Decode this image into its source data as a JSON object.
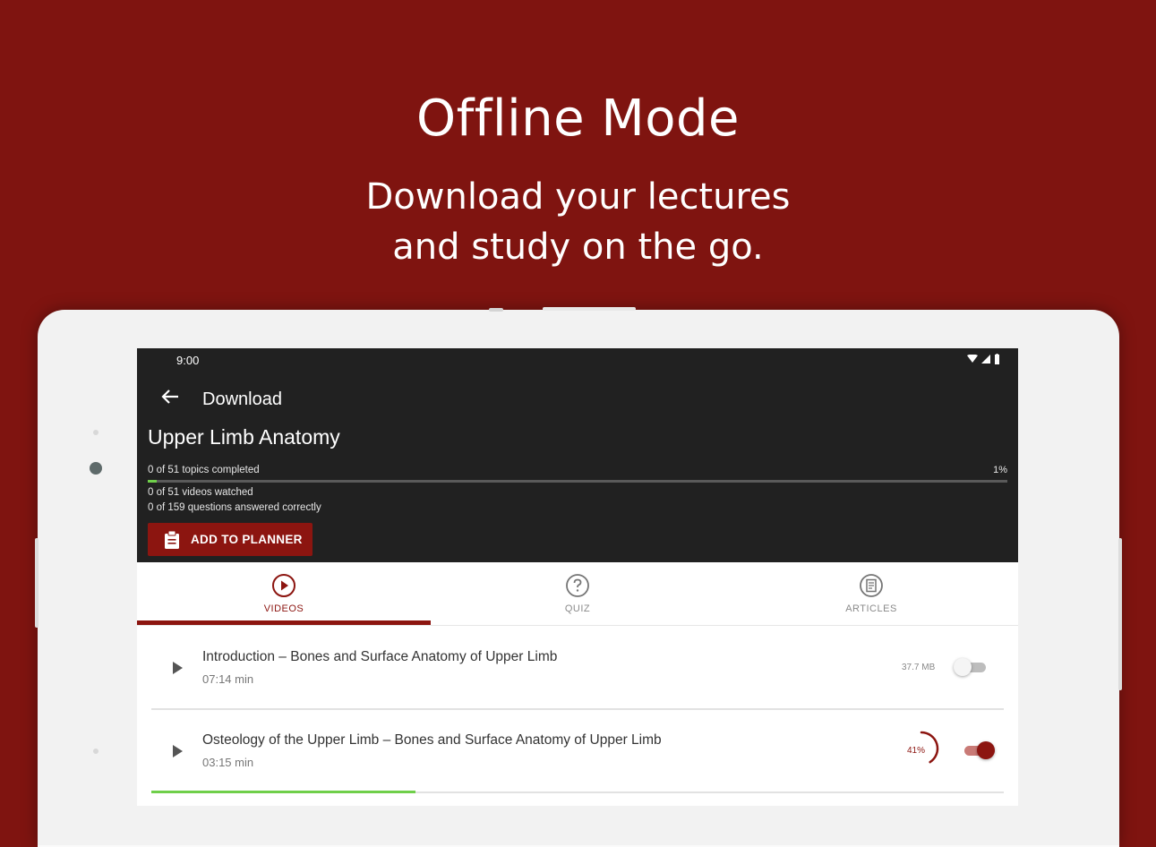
{
  "promo": {
    "headline": "Offline Mode",
    "subline_1": "Download your lectures",
    "subline_2": "and study on the go."
  },
  "status_bar": {
    "time": "9:00"
  },
  "app_bar": {
    "title": "Download",
    "back_icon": "arrow-back-icon"
  },
  "course": {
    "title": "Upper Limb Anatomy",
    "topics_completed": "0 of 51 topics completed",
    "progress_label": "1%",
    "progress": 0.01,
    "videos_watched": "0 of 51 videos watched",
    "questions_correct": "0 of 159 questions answered correctly"
  },
  "planner_button": {
    "label": "ADD TO PLANNER",
    "icon": "clipboard-icon"
  },
  "tabs": [
    {
      "label": "VIDEOS",
      "icon": "play-circle-icon",
      "active": true
    },
    {
      "label": "QUIZ",
      "icon": "question-circle-icon",
      "active": false
    },
    {
      "label": "ARTICLES",
      "icon": "article-icon",
      "active": false
    }
  ],
  "videos": [
    {
      "title": "Introduction – Bones and Surface Anatomy of Upper Limb",
      "duration": "07:14 min",
      "size": "37.7 MB",
      "download_on": false
    },
    {
      "title": "Osteology of the Upper Limb – Bones and Surface Anatomy of Upper Limb",
      "duration": "03:15 min",
      "download_progress_label": "41%",
      "download_progress": 0.41,
      "download_on": true,
      "watch_progress": 0.31
    }
  ],
  "colors": {
    "brand": "#8c1510",
    "background": "#7f1410",
    "appbar": "#212121",
    "progress": "#6fcf4a"
  }
}
